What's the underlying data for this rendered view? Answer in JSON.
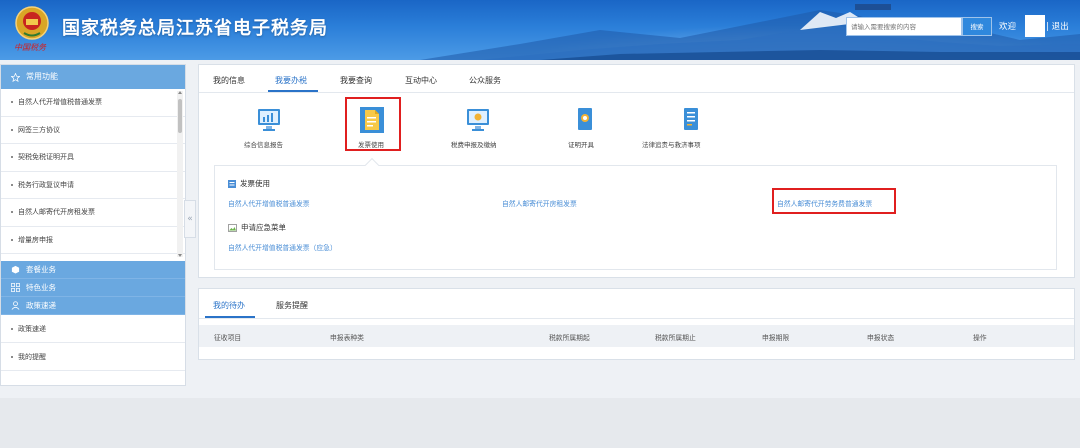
{
  "header": {
    "title": "国家税务总局江苏省电子税务局",
    "brand_script": "中国税务",
    "search_placeholder": "请输入需要搜索的内容",
    "search_button": "搜索",
    "welcome": "欢迎",
    "logout": "| 退出"
  },
  "sidebar": {
    "head": "常用功能",
    "items": [
      "自然人代开增值税普通发票",
      "网签三方协议",
      "契税免税证明开具",
      "税务行政复议申请",
      "自然人邮寄代开房租发票",
      "增量房申报"
    ],
    "groups": [
      "套餐业务",
      "特色业务",
      "政策速递"
    ],
    "bottom_items": [
      "政策速递",
      "我的提醒"
    ]
  },
  "main_tabs": [
    "我的信息",
    "我要办税",
    "我要查询",
    "互动中心",
    "公众服务"
  ],
  "functions": [
    {
      "label": "综合信息报告",
      "icon": "report-icon"
    },
    {
      "label": "发票使用",
      "icon": "invoice-icon"
    },
    {
      "label": "税费申报及缴纳",
      "icon": "declare-icon"
    },
    {
      "label": "证明开具",
      "icon": "certificate-icon"
    },
    {
      "label": "法律追责与救济事项",
      "icon": "legal-icon"
    }
  ],
  "invoice_section": {
    "title": "发票使用",
    "links": [
      "自然人代开增值税普通发票",
      "自然人邮寄代开房租发票",
      "自然人邮寄代开劳务费普通发票"
    ]
  },
  "emergency_section": {
    "title": "申请应急菜单",
    "links": [
      "自然人代开增值税普通发票（应急）"
    ]
  },
  "bottom_tabs": [
    "我的待办",
    "服务提醒"
  ],
  "table_headers": [
    "征收项目",
    "申报表种类",
    "税款所属期起",
    "税款所属期止",
    "申报期限",
    "申报状态",
    "操作"
  ],
  "colors": {
    "accent": "#2a73c8",
    "sidebar_blue": "#6aa8e0",
    "link": "#4a8ed6",
    "highlight": "#e01f1f"
  }
}
